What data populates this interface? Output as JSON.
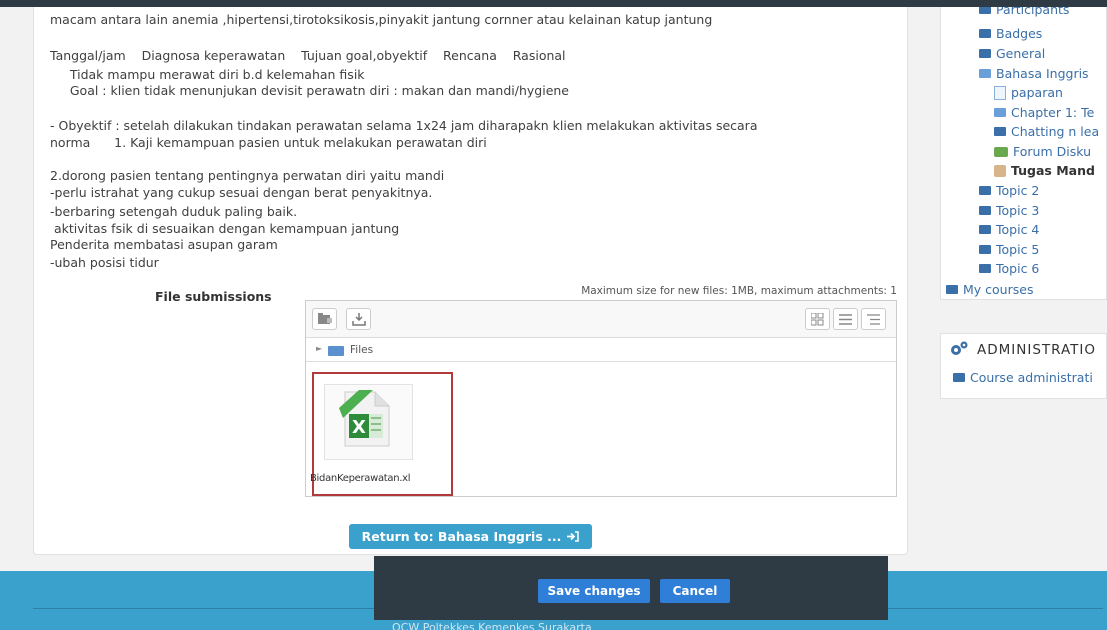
{
  "essay": {
    "lines": [
      "macam antara lain anemia ,hipertensi,tirotoksikosis,pinyakit jantung cornner atau kelainan katup jantung",
      "Tanggal/jam    Diagnosa keperawatan    Tujuan goal,obyektif    Rencana    Rasional",
      "     Tidak mampu merawat diri b.d kelemahan fisik",
      "     Goal : klien tidak menunjukan devisit perawatn diri : makan dan mandi/hygiene",
      "- Obyektif : setelah dilakukan tindakan perawatan selama 1x24 jam diharapakn klien melakukan aktivitas secara",
      "norma      1. Kaji kemampuan pasien untuk melakukan perawatan diri",
      "2.dorong pasien tentang pentingnya perwatan diri yaitu mandi",
      "-perlu istrahat yang cukup sesuai dengan berat penyakitnya.",
      "-berbaring setengah duduk paling baik.",
      " aktivitas fsik di sesuaikan dengan kemampuan jantung",
      "Penderita membatasi asupan garam",
      "-ubah posisi tidur"
    ]
  },
  "file_submissions": {
    "label": "File submissions",
    "max_info": "Maximum size for new files: 1MB, maximum attachments: 1",
    "path_label": "Files",
    "file_name": "BidanKeperawatan.xl"
  },
  "return_button": "Return to: Bahasa Inggris ...",
  "actions": {
    "save": "Save changes",
    "cancel": "Cancel"
  },
  "nav": {
    "items": [
      {
        "label": "Participants"
      },
      {
        "label": "Badges"
      },
      {
        "label": "General"
      },
      {
        "label": "Bahasa Inggris"
      },
      {
        "label": "paparan"
      },
      {
        "label": "Chapter 1: Te"
      },
      {
        "label": "Chatting n lea"
      },
      {
        "label": "Forum Disku"
      },
      {
        "label": "Tugas Mand"
      },
      {
        "label": "Topic 2"
      },
      {
        "label": "Topic 3"
      },
      {
        "label": "Topic 4"
      },
      {
        "label": "Topic 5"
      },
      {
        "label": "Topic 6"
      },
      {
        "label": "My courses"
      }
    ]
  },
  "admin": {
    "title": "ADMINISTRATIO",
    "item": "Course administrati"
  },
  "footer": {
    "text": "OCW Poltekkes Kemenkes Surakarta"
  },
  "colors": {
    "accent": "#3aa0cc",
    "dark": "#2e3a44",
    "button": "#2f7ed8",
    "highlight": "#b33a3a"
  }
}
